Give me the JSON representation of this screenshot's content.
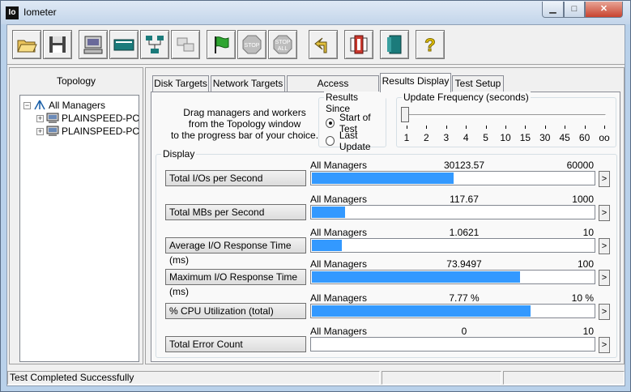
{
  "window": {
    "title": "Iometer",
    "app_icon_text": "Io"
  },
  "toolbar": {
    "buttons": [
      {
        "name": "open-config-button",
        "icon": "folder-open-icon"
      },
      {
        "name": "save-config-button",
        "icon": "floppy-disk-icon"
      },
      {
        "name": "show-results-display-button",
        "icon": "monitor-icon"
      },
      {
        "name": "new-manager-button",
        "icon": "computer-icon"
      },
      {
        "name": "new-worker-button",
        "icon": "network-icon"
      },
      {
        "name": "duplicate-worker-button",
        "icon": "duplicate-icon"
      },
      {
        "name": "start-tests-button",
        "icon": "green-flag-icon"
      },
      {
        "name": "stop-button",
        "icon": "stop-sign-icon",
        "text": "STOP"
      },
      {
        "name": "stop-all-button",
        "icon": "stop-all-icon",
        "text1": "STOP",
        "text2": "ALL"
      },
      {
        "name": "reset-workers-button",
        "icon": "reset-arrow-icon"
      },
      {
        "name": "exit-button",
        "icon": "exit-door-icon"
      },
      {
        "name": "help-button",
        "icon": "help-icon",
        "text": "?"
      }
    ]
  },
  "topology": {
    "label": "Topology",
    "root": "All Managers",
    "children": [
      "PLAINSPEED-PC",
      "PLAINSPEED-PC"
    ]
  },
  "tabs": [
    {
      "label": "Disk Targets",
      "active": false
    },
    {
      "label": "Network Targets",
      "active": false
    },
    {
      "label": "Access Specifications",
      "active": false
    },
    {
      "label": "Results Display",
      "active": true
    },
    {
      "label": "Test Setup",
      "active": false
    }
  ],
  "results": {
    "drag_hint_lines": [
      "Drag managers and workers",
      "from the Topology window",
      "to the progress bar of your choice."
    ],
    "since": {
      "label": "Results Since",
      "options": [
        {
          "label": "Start of Test",
          "selected": true
        },
        {
          "label": "Last Update",
          "selected": false
        }
      ]
    },
    "update_frequency": {
      "label": "Update Frequency (seconds)",
      "ticks": [
        "1",
        "2",
        "3",
        "4",
        "5",
        "10",
        "15",
        "30",
        "45",
        "60",
        "oo"
      ],
      "selected": "1"
    },
    "display_label": "Display",
    "metrics": [
      {
        "button": "Total I/Os per Second",
        "source": "All Managers",
        "value": "30123.57",
        "max": "60000",
        "fraction": 0.502
      },
      {
        "button": "Total MBs per Second",
        "source": "All Managers",
        "value": "117.67",
        "max": "1000",
        "fraction": 0.118
      },
      {
        "button": "Average I/O Response Time (ms)",
        "source": "All Managers",
        "value": "1.0621",
        "max": "10",
        "fraction": 0.106
      },
      {
        "button": "Maximum I/O Response Time (ms)",
        "source": "All Managers",
        "value": "73.9497",
        "max": "100",
        "fraction": 0.739
      },
      {
        "button": "% CPU Utilization (total)",
        "source": "All Managers",
        "value": "7.77 %",
        "max": "10 %",
        "fraction": 0.777
      },
      {
        "button": "Total Error Count",
        "source": "All Managers",
        "value": "0",
        "max": "10",
        "fraction": 0
      }
    ],
    "more_glyph": ">"
  },
  "status_bar": {
    "message": "Test Completed Successfully"
  },
  "colors": {
    "bar_fill": "#3399ff",
    "titlebar": "#c3d5ea",
    "close": "#c8432f"
  }
}
